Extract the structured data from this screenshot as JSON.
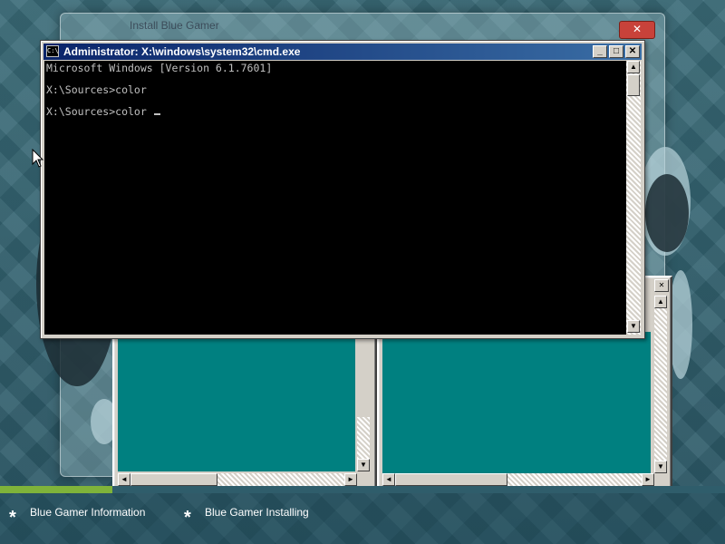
{
  "setup": {
    "title": "Install Blue Gamer",
    "close_glyph": "✕"
  },
  "cmd": {
    "title": "Administrator: X:\\windows\\system32\\cmd.exe",
    "icon_text": "C:\\",
    "lines": [
      "Microsoft Windows [Version 6.1.7601]",
      "",
      "X:\\Sources>color",
      "",
      "X:\\Sources>color "
    ],
    "buttons": {
      "minimize": "_",
      "maximize": "□",
      "close": "✕"
    }
  },
  "classic_windows": {
    "close_glyph": "✕",
    "scroll_up": "▲",
    "scroll_down": "▼",
    "scroll_left": "◄",
    "scroll_right": "►"
  },
  "progress": {
    "value": 0.155,
    "color": "#7fb33a"
  },
  "steps": [
    {
      "label": "Blue Gamer Information"
    },
    {
      "label": "Blue Gamer Installing"
    }
  ],
  "icons": {
    "pointer": "mouse-pointer-icon",
    "step_bullet": "asterisk-icon"
  }
}
